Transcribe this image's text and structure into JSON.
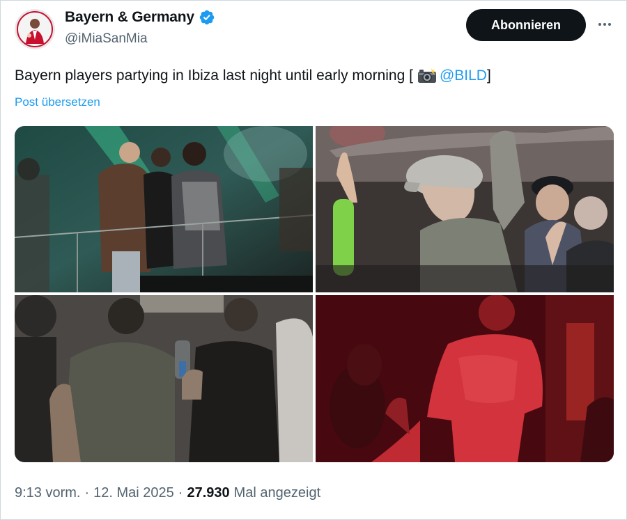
{
  "account": {
    "display_name": "Bayern & Germany",
    "handle": "@iMiaSanMia",
    "verified_icon": "verified-badge-icon",
    "verified_color": "#1d9bf0"
  },
  "actions": {
    "subscribe_label": "Abonnieren",
    "more_icon": "more-options-icon"
  },
  "post": {
    "text_main": "Bayern players partying in Ibiza last night until early morning [",
    "camera_icon": "camera-flash-icon",
    "mention": "@BILD",
    "text_end": "]",
    "translate_label": "Post übersetzen"
  },
  "media": {
    "photos": [
      {
        "name": "photo-balcony-group"
      },
      {
        "name": "photo-crowd-cap"
      },
      {
        "name": "photo-dark-crowd"
      },
      {
        "name": "photo-red-dancer"
      }
    ]
  },
  "footer": {
    "time": "9:13 vorm.",
    "separator": "·",
    "date": "12. Mai 2025",
    "views_count": "27.930",
    "views_label": "Mal angezeigt"
  },
  "colors": {
    "link": "#1d9bf0",
    "text": "#0f1419",
    "secondary": "#536471",
    "button_bg": "#0f1419"
  }
}
